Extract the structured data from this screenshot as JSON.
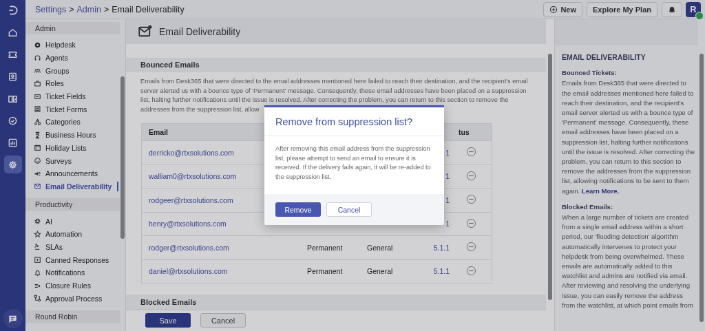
{
  "rail": {
    "items": [
      {
        "kind": "logo",
        "selected": false
      },
      {
        "kind": "home",
        "selected": false
      },
      {
        "kind": "ticket",
        "selected": false
      },
      {
        "kind": "contact",
        "selected": false
      },
      {
        "kind": "book",
        "selected": false
      },
      {
        "kind": "check",
        "selected": false
      },
      {
        "kind": "chart",
        "selected": false
      },
      {
        "kind": "gear",
        "selected": true
      },
      {
        "kind": "chat",
        "selected": false
      }
    ]
  },
  "top_bar": {
    "breadcrumb": [
      "Settings",
      "Admin",
      "Email Deliverability"
    ],
    "separator": ">",
    "new_button": "New",
    "plan_button": "Explore My Plan",
    "avatar": "R",
    "avatar_online": true
  },
  "sidebar": {
    "groups": [
      {
        "title": "Admin",
        "items": [
          {
            "label": "Helpdesk",
            "selected": false
          },
          {
            "label": "Agents",
            "selected": false
          },
          {
            "label": "Groups",
            "selected": false
          },
          {
            "label": "Roles",
            "selected": false
          },
          {
            "label": "Ticket Fields",
            "selected": false
          },
          {
            "label": "Ticket Forms",
            "selected": false
          },
          {
            "label": "Categories",
            "selected": false
          },
          {
            "label": "Business Hours",
            "selected": false
          },
          {
            "label": "Holiday Lists",
            "selected": false
          },
          {
            "label": "Surveys",
            "selected": false
          },
          {
            "label": "Announcements",
            "selected": false
          },
          {
            "label": "Email Deliverability",
            "selected": true
          }
        ]
      },
      {
        "title": "Productivity",
        "items": [
          {
            "label": "AI",
            "selected": false
          },
          {
            "label": "Automation",
            "selected": false
          },
          {
            "label": "SLAs",
            "selected": false
          },
          {
            "label": "Canned Responses",
            "selected": false
          },
          {
            "label": "Notifications",
            "selected": false
          },
          {
            "label": "Closure Rules",
            "selected": false
          },
          {
            "label": "Approval Process",
            "selected": false
          }
        ]
      },
      {
        "title": "Round Robin"
      }
    ]
  },
  "page": {
    "title": "Email Deliverability"
  },
  "bounced": {
    "title": "Bounced Emails",
    "description_lines": [
      "Emails from Desk365 that were directed to the email addresses mentioned here failed to reach their destination, and the recipient's email",
      "server alerted us with a bounce type of 'Permanent' message. Consequently, these email addresses have been placed on a suppression",
      "list, halting further notifications until the issue is resolved. After correcting the problem, you can return to this section to remove the",
      "addresses from the suppression list, allow"
    ],
    "columns": {
      "column_1": "Email",
      "column_4": "tus"
    },
    "rows": [
      {
        "email": "derricko@rtxsolutions.com",
        "code": "1"
      },
      {
        "email": "walliam0@rtxsolutions.com",
        "code": "1"
      },
      {
        "email": "rodgeer@rtxsolutions.com",
        "code": "1"
      },
      {
        "email": "henry@rtxsolutions.com",
        "code": "1"
      },
      {
        "email": "rodger@rtxsolutions.com",
        "bounce_type": "Permanent",
        "category": "General",
        "code": "5.1.1"
      },
      {
        "email": "daniel@rtxsolutions.com",
        "bounce_type": "Permanent",
        "category": "General",
        "code": "5.1.1"
      }
    ]
  },
  "blocked": {
    "title": "Blocked Emails"
  },
  "footer": {
    "save": "Save",
    "cancel": "Cancel"
  },
  "help": {
    "title": "EMAIL DELIVERABILITY",
    "sections": [
      {
        "heading": "Bounced Tickets:",
        "text": "Emails from Desk365 that were directed to the email addresses mentioned here failed to reach their destination, and the recipient's email server alerted us with a bounce type of 'Permanent' message. Consequently, these email addresses have been placed on a suppression list, halting further notifications until the issue is resolved. After correcting the problem, you can return to this section to remove the addresses from the suppression list, allowing notifications to be sent to them again.",
        "link": "Learn More."
      },
      {
        "heading": "Blocked Emails:",
        "text": "When a large number of tickets are created from a single email address within a short period, our 'flooding detection' algorithm automatically intervenes to protect your helpdesk from being overwhelmed. These emails are automatically added to this watchlist and admins are notified via email. After reviewing and resolving the underlying issue, you can easily remove the address from the watchlist, at which point emails from"
      }
    ]
  },
  "dialog": {
    "title": "Remove from suppression list?",
    "body": "After removing this email address from the suppression list, please attempt to send an email to ensure it is received. If the delivery fails again, it will be re-added to the suppression list.",
    "confirm": "Remove",
    "cancel": "Cancel"
  }
}
